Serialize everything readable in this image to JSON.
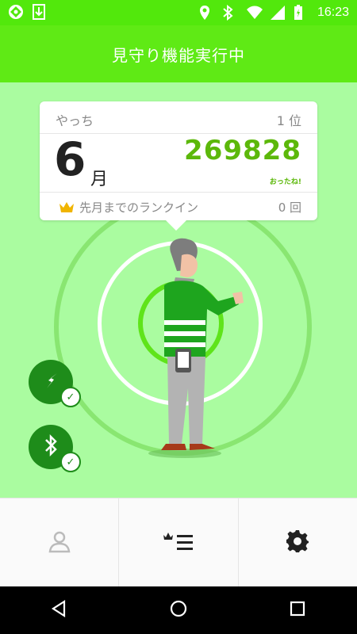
{
  "status_bar": {
    "time": "16:23",
    "left_icons": [
      "app-icon",
      "download-icon"
    ],
    "right_icons": [
      "location-icon",
      "bluetooth-icon",
      "wifi-icon",
      "signal-icon",
      "battery-charging-icon"
    ]
  },
  "header": {
    "title": "見守り機能実行中"
  },
  "card": {
    "name": "やっち",
    "rank": "1 位",
    "month_number": "6",
    "month_unit": "月",
    "steps": "269828",
    "steps_note": "おったね!",
    "rankin_label": "先月までのランクイン",
    "rankin_count": "0 回"
  },
  "status_buttons": [
    {
      "name": "location-status",
      "icon": "compass-icon",
      "checked": true
    },
    {
      "name": "bluetooth-status",
      "icon": "bluetooth-icon",
      "checked": true
    }
  ],
  "bottom_tabs": [
    {
      "name": "tab-profile",
      "icon": "person-icon"
    },
    {
      "name": "tab-ranking",
      "icon": "ranking-list-icon"
    },
    {
      "name": "tab-settings",
      "icon": "gear-icon"
    }
  ],
  "nav": [
    "back-icon",
    "home-icon",
    "recents-icon"
  ],
  "colors": {
    "status_bar": "#52e80c",
    "header": "#5fea15",
    "main_bg": "#aafca0",
    "accent_green": "#5cb80a",
    "dark_green": "#1e8c1a"
  }
}
